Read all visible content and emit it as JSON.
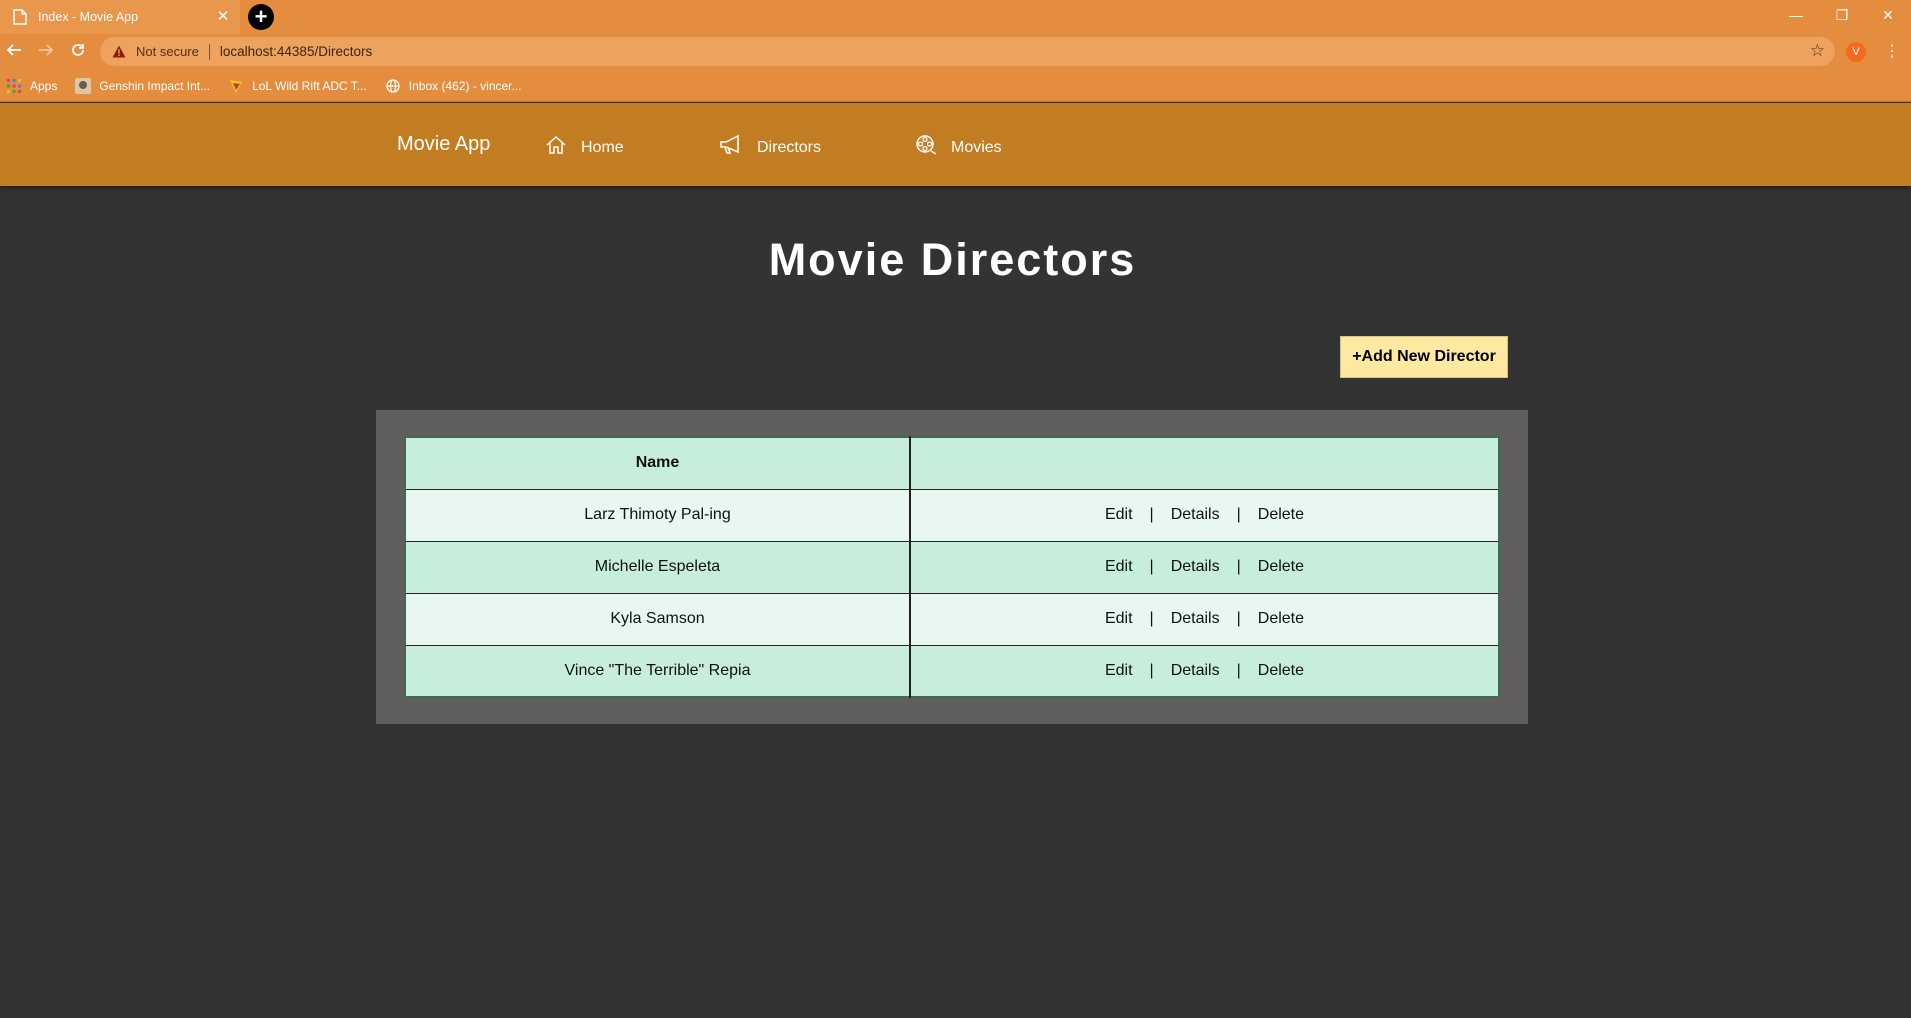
{
  "browser": {
    "tab_title": "Index - Movie App",
    "tab_close": "✕",
    "new_tab": "+",
    "window_controls": {
      "minimize": "—",
      "restore": "❐",
      "close": "✕"
    },
    "not_secure": "Not secure",
    "url": "localhost:44385/Directors",
    "profile_initial": "V",
    "bookmarks": [
      {
        "label": "Apps",
        "icon": "apps-grid-icon"
      },
      {
        "label": "Genshin Impact Int...",
        "icon": "genshin-icon"
      },
      {
        "label": "LoL Wild Rift ADC T...",
        "icon": "wild-rift-icon"
      },
      {
        "label": "Inbox (462) - vincer...",
        "icon": "globe-icon"
      }
    ]
  },
  "nav": {
    "brand": "Movie App",
    "items": [
      {
        "label": "Home",
        "icon": "home-icon"
      },
      {
        "label": "Directors",
        "icon": "megaphone-icon"
      },
      {
        "label": "Movies",
        "icon": "film-reel-icon"
      }
    ]
  },
  "page": {
    "title": "Movie Directors",
    "add_button": "+Add New Director"
  },
  "table": {
    "columns": [
      "Name",
      ""
    ],
    "actions": {
      "edit": "Edit",
      "details": "Details",
      "delete": "Delete",
      "separator": "|"
    },
    "rows": [
      {
        "name": "Larz Thimoty Pal-ing"
      },
      {
        "name": "Michelle Espeleta"
      },
      {
        "name": "Kyla Samson"
      },
      {
        "name": "Vince \"The Terrible\" Repia"
      }
    ]
  },
  "colors": {
    "chrome": "#e58d3e",
    "navbar": "#c27c22",
    "page_bg": "#333333",
    "panel": "#615e5e",
    "row_dark": "#c7eedb",
    "row_light": "#e8f7f0",
    "button": "#fde9a2"
  }
}
